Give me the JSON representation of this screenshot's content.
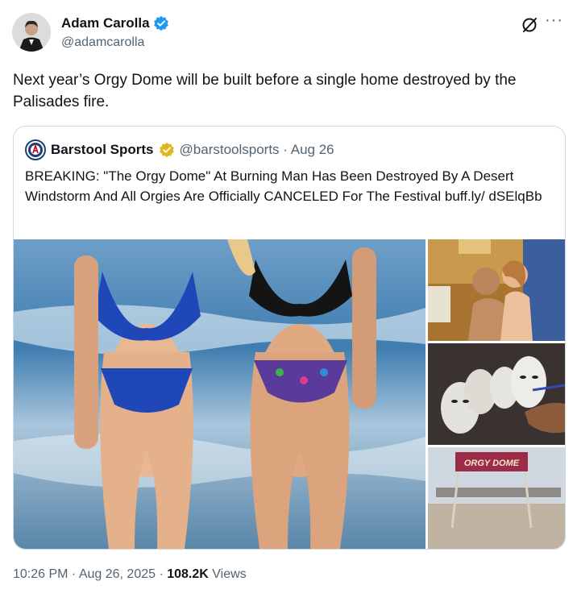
{
  "author": {
    "name": "Adam Carolla",
    "handle": "@adamcarolla"
  },
  "tweet": {
    "text": "Next year’s Orgy Dome will be built before a single home destroyed by the Palisades fire."
  },
  "quoted": {
    "name": "Barstool Sports",
    "meta": "@barstoolsports · Aug 26",
    "text": "BREAKING: \"The Orgy Dome\" At Burning Man Has Been Destroyed By A Desert Windstorm And All Orgies Are Officially CANCELED For The Festival buff.ly/ dSElqBb",
    "sign_text": "ORGY DOME"
  },
  "footer": {
    "time": "10:26 PM · Aug 26, 2025 · ",
    "views_count": "108.2K",
    "views_label": " Views"
  },
  "icons": {
    "verified_author": "verified-blue-icon",
    "verified_quoted": "verified-gold-icon",
    "grok": "grok-icon",
    "more": "more-icon"
  },
  "colors": {
    "verified_blue": "#1d9bf0",
    "verified_gold": "#e2b719",
    "muted": "#536471",
    "border": "#cfd9de"
  }
}
